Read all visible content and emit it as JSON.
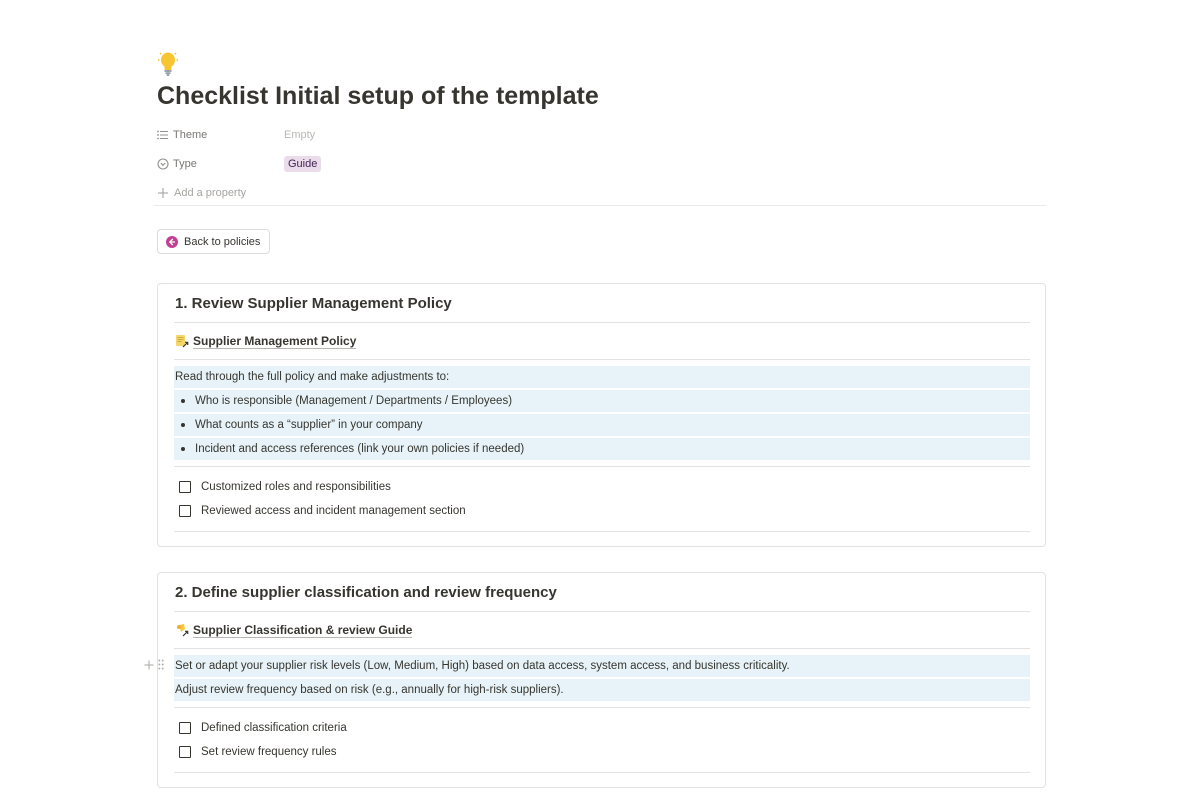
{
  "page": {
    "icon": "lightbulb-icon",
    "title": "Checklist Initial setup of the template"
  },
  "properties": {
    "theme_label": "Theme",
    "theme_value": "Empty",
    "type_label": "Type",
    "type_value": "Guide",
    "add_property": "Add a property"
  },
  "back_button": {
    "label": "Back to policies",
    "icon": "arrow-left-circle-icon",
    "icon_color": "#c33f94"
  },
  "sections": [
    {
      "title": "1. Review Supplier Management Policy",
      "link_label": "Supplier Management Policy",
      "link_icon": "document-link-icon",
      "intro": "Read through the full policy and make adjustments to:",
      "bullets": [
        "Who is responsible (Management / Departments / Employees)",
        "What counts as a “supplier” in your company",
        "Incident and access references (link your own policies if needed)"
      ],
      "checklist": [
        "Customized roles and responsibilities",
        "Reviewed access and incident management section"
      ]
    },
    {
      "title": "2. Define supplier classification and review frequency",
      "link_label": "Supplier Classification & review Guide",
      "link_icon": "guide-link-icon",
      "lines": [
        "Set or adapt your supplier risk levels (Low, Medium, High) based on data access, system access, and business criticality.",
        "Adjust review frequency based on risk (e.g., annually for high-risk suppliers)."
      ],
      "checklist": [
        "Defined classification criteria",
        "Set review frequency rules"
      ]
    }
  ],
  "colors": {
    "highlight_bg": "#e7f3f8",
    "tag_bg": "#eadcea",
    "text": "#37352f"
  }
}
